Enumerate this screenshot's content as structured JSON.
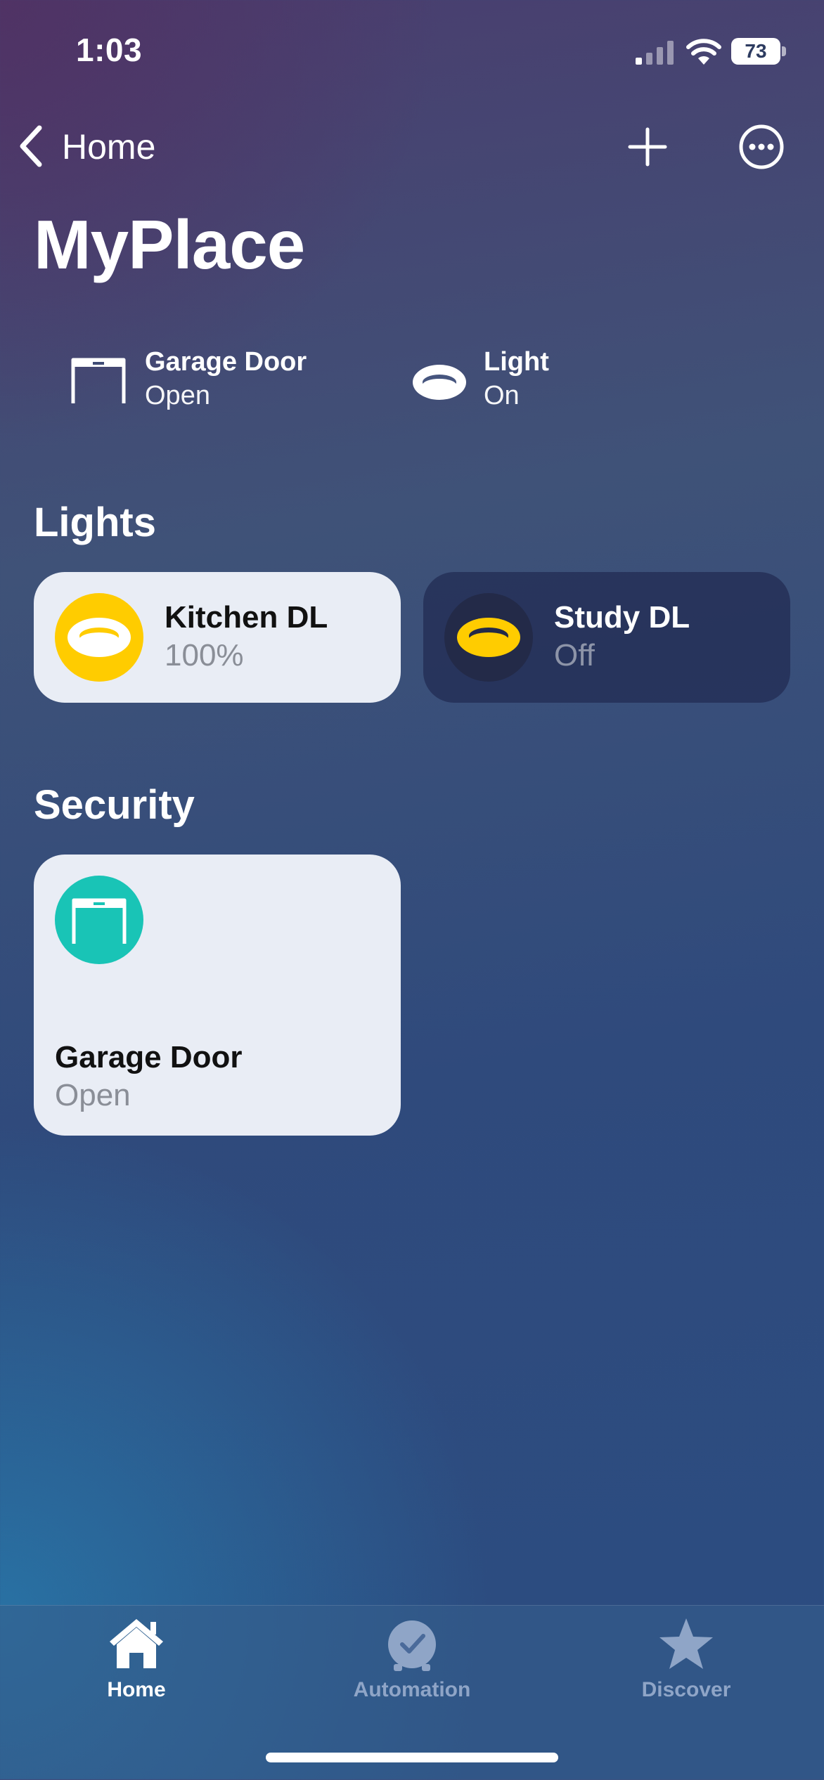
{
  "status_bar": {
    "time": "1:03",
    "battery": "73"
  },
  "nav": {
    "back_label": "Home"
  },
  "page_title": "MyPlace",
  "summary": [
    {
      "title": "Garage Door",
      "status": "Open",
      "icon": "garage-door-icon"
    },
    {
      "title": "Light",
      "status": "On",
      "icon": "downlight-icon"
    }
  ],
  "sections": {
    "lights": {
      "title": "Lights",
      "tiles": [
        {
          "name": "Kitchen DL",
          "status": "100%",
          "icon": "downlight-icon",
          "state": "on"
        },
        {
          "name": "Study DL",
          "status": "Off",
          "icon": "downlight-icon",
          "state": "off"
        }
      ]
    },
    "security": {
      "title": "Security",
      "tiles": [
        {
          "name": "Garage Door",
          "status": "Open",
          "icon": "garage-door-icon",
          "state": "open"
        }
      ]
    }
  },
  "tabbar": {
    "tabs": [
      {
        "label": "Home",
        "icon": "house-icon",
        "selected": true
      },
      {
        "label": "Automation",
        "icon": "clock-check-icon",
        "selected": false
      },
      {
        "label": "Discover",
        "icon": "star-icon",
        "selected": false
      }
    ]
  },
  "colors": {
    "light_on": "#ffcc00",
    "garage_accent": "#19c4b6",
    "tile_light_bg": "#e9edf5",
    "tile_dark_bg": "#2a3560"
  }
}
